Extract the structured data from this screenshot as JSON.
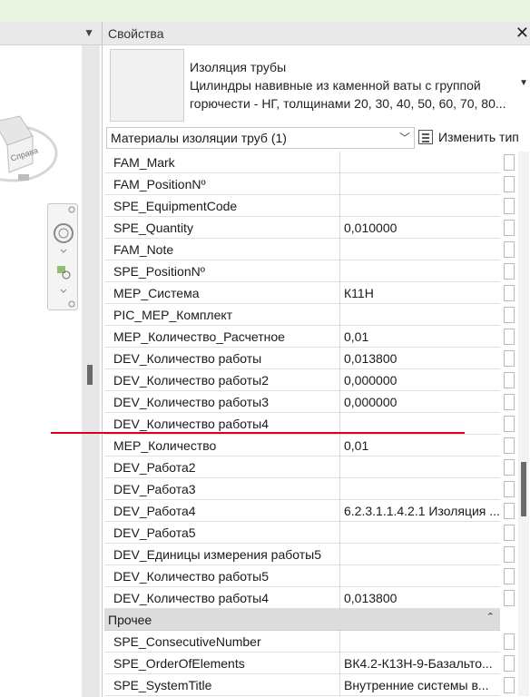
{
  "properties_panel": {
    "title": "Свойства",
    "close_glyph": "✕",
    "type_name_lines": [
      "Изоляция трубы",
      "Цилиндры навивные из каменной ваты с группой",
      "горючести - НГ, толщинами 20, 30, 40, 50, 60, 70, 80..."
    ],
    "filter_value": "Материалы изоляции труб (1)",
    "edit_type_label": "Изменить тип"
  },
  "parameters": [
    {
      "name": "FAM_Mark",
      "value": ""
    },
    {
      "name": "FAM_PositionNº",
      "value": ""
    },
    {
      "name": "SPE_EquipmentCode",
      "value": ""
    },
    {
      "name": "SPE_Quantity",
      "value": "0,010000"
    },
    {
      "name": "FAM_Note",
      "value": ""
    },
    {
      "name": "SPE_PositionNº",
      "value": ""
    },
    {
      "name": "MEP_Система",
      "value": "К11Н"
    },
    {
      "name": "PIC_MEP_Комплект",
      "value": ""
    },
    {
      "name": "MEP_Количество_Расчетное",
      "value": "0,01"
    },
    {
      "name": "DEV_Количество работы",
      "value": "0,013800"
    },
    {
      "name": "DEV_Количество работы2",
      "value": "0,000000"
    },
    {
      "name": "DEV_Количество работы3",
      "value": "0,000000"
    },
    {
      "name": "DEV_Количество работы4",
      "value": ""
    },
    {
      "name": "MEP_Количество",
      "value": "0,01"
    },
    {
      "name": "DEV_Работа2",
      "value": ""
    },
    {
      "name": "DEV_Работа3",
      "value": ""
    },
    {
      "name": "DEV_Работа4",
      "value": "6.2.3.1.1.4.2.1 Изоляция ..."
    },
    {
      "name": "DEV_Работа5",
      "value": ""
    },
    {
      "name": "DEV_Единицы измерения работы5",
      "value": ""
    },
    {
      "name": "DEV_Количество работы5",
      "value": ""
    },
    {
      "name": "DEV_Количество работы4",
      "value": "0,013800"
    }
  ],
  "group_other": {
    "label": "Прочее",
    "collapse_glyph": "⌃"
  },
  "other_parameters": [
    {
      "name": "SPE_ConsecutiveNumber",
      "value": ""
    },
    {
      "name": "SPE_OrderOfElements",
      "value": "ВК4.2-К13Н-9-Базальто..."
    },
    {
      "name": "SPE_SystemTitle",
      "value": "Внутренние системы в..."
    }
  ],
  "viewcube": {
    "label": "Справа"
  },
  "colors": {
    "annotation_line": "#d9001b"
  }
}
